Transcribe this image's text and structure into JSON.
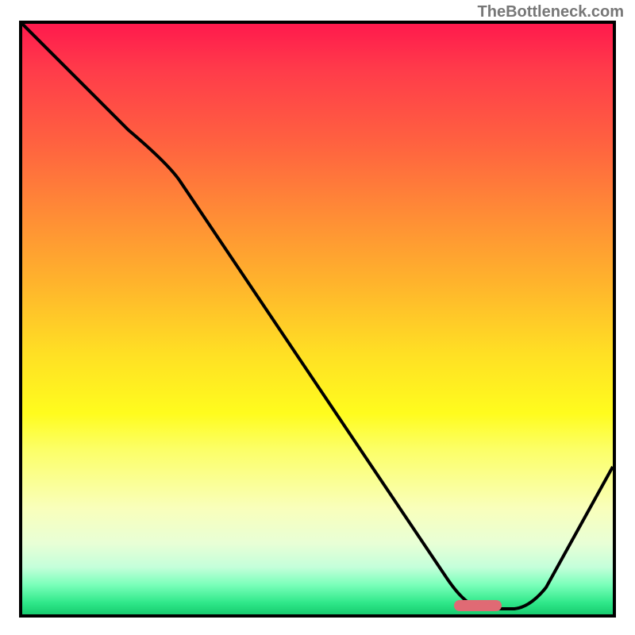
{
  "watermark": "TheBottleneck.com",
  "chart_data": {
    "type": "line",
    "title": "",
    "xlabel": "",
    "ylabel": "",
    "xlim": [
      0,
      100
    ],
    "ylim": [
      0,
      100
    ],
    "grid": false,
    "background": "gradient red-yellow-green vertical",
    "series": [
      {
        "name": "curve",
        "x": [
          0,
          18,
          25,
          72,
          76,
          80,
          84,
          100
        ],
        "values": [
          100,
          82,
          76,
          6,
          2,
          1,
          2,
          25
        ]
      }
    ],
    "marker": {
      "x": 77,
      "y": 1,
      "width_pct": 8
    }
  }
}
